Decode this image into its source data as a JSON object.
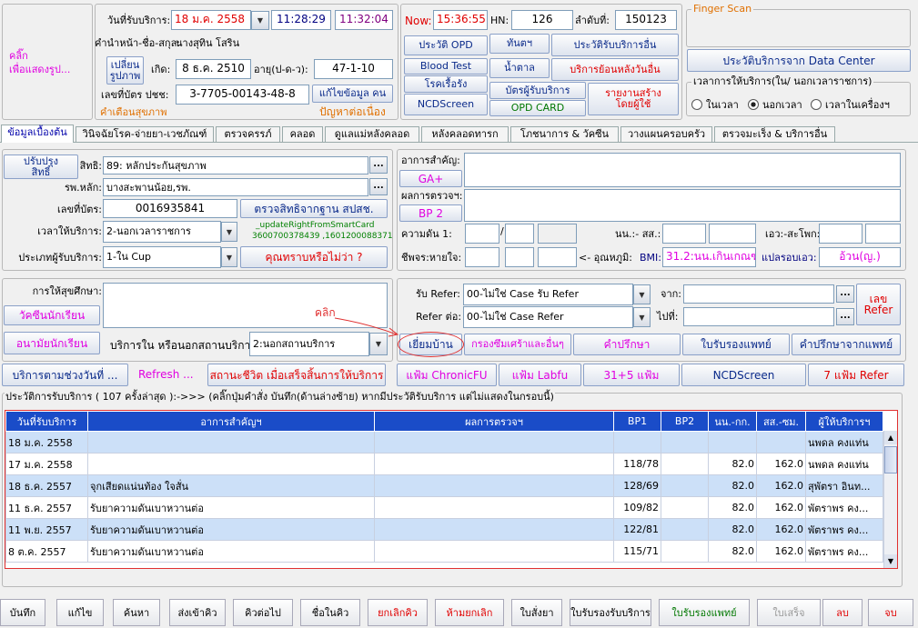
{
  "photo_area": {
    "click_label": "คลิ๊ก\nเพื่อแสดงรูป...",
    "change_photo_btn": "เปลี่ยน\nรูปภาพ",
    "warning": "คำเตือนสุขภาพ"
  },
  "patient": {
    "service_date_label": "วันที่รับบริการ:",
    "service_date": "18 ม.ค. 2558",
    "time_start": "11:28:29",
    "time_end": "11:32:04",
    "name_label": "คำนำหน้า-ชื่อ-สกุล:",
    "name": "นางสุทิน  โสริน",
    "dob_label": "เกิด:",
    "dob": "8 ธ.ค. 2510",
    "age_label": "อายุ(ป-ด-ว):",
    "age": "47-1-10",
    "cid_label": "เลขที่บัตร ปชช:",
    "cid": "3-7705-00143-48-8",
    "edit_btn": "แก้ไขข้อมูล คน",
    "problem_link": "ปัญหาต่อเนื่อง"
  },
  "visit": {
    "now_label": "Now:",
    "now": "15:36:55",
    "hn_label": "HN:",
    "hn": "126",
    "vn_label": "ลำดับที่:",
    "vn": "150123",
    "buttons": [
      "ประวัติ OPD",
      "ทันตฯ",
      "ประวัติรับบริการอื่น",
      "Blood Test",
      "น้ำตาล",
      "บริการย้อนหลังวันอื่น",
      "โรคเรื้อรัง",
      "บัตรผู้รับบริการ",
      "รายงานสร้าง\nโดยผู้ใช้ ",
      "NCDScreen",
      "OPD CARD"
    ]
  },
  "finger": {
    "title": "Finger Scan",
    "dc_btn": "ประวัติบริการจาก Data Center",
    "time_group": "เวลาการให้บริการ(ใน/ นอกเวลาราชการ)",
    "radios": [
      "ในเวลา",
      "นอกเวลา",
      "เวลาในเครื่องฯ"
    ],
    "selected": "นอกเวลา"
  },
  "tabs": [
    "ข้อมูลเบื้องต้น",
    "วินิจฉัยโรค-จ่ายยา-เวชภัณฑ์",
    "ตรวจครรภ์",
    "คลอด",
    "ดูแลแม่หลังคลอด",
    "หลังคลอดทารก",
    "โภชนาการ & วัคซีน",
    "วางแผนครอบครัว",
    "ตรวจมะเร็ง & บริการอื่น"
  ],
  "basic": {
    "update_right_btn": "ปรับปรุง\nสิทธิ์",
    "right_label": "สิทธิ:",
    "right": "89: หลักประกันสุขภาพ",
    "main_hosp_label": "รพ.หลัก:",
    "main_hosp": "บางสะพานน้อย,รพ.",
    "card_label": "เลขที่บัตร:",
    "card": "0016935841",
    "check_right_btn": "ตรวจสิทธิจากฐาน สปสช.",
    "time_label": "เวลาให้บริการ:",
    "time_value": "2-นอกเวลาราชการ",
    "smartcard_note": "_updateRightFromSmartCard",
    "smartcard_ids": "3600700378439 ,1601200088371",
    "type_label": "ประเภทผู้รับบริการ:",
    "type_value": "1-ใน Cup",
    "know_btn": "คุณทราบหรือไม่ว่า ?"
  },
  "exam": {
    "complaint_label": "อาการสำคัญ:",
    "ga_btn": "GA+",
    "result_label": "ผลการตรวจฯ:",
    "bp_btn": "BP 2",
    "bp_label": "ความดัน 1:",
    "slash": "/",
    "weight_label": "นน.:- สส.:",
    "waist_label": "เอว:-สะโพก:",
    "pulse_label": "ชีพจร:หายใจ:",
    "temp_label": "<- อุณหภูมิ:",
    "bmi_label": "BMI:",
    "bmi": "31.2:นน.เกินเกณฑ์",
    "waist_interp_label": "แปลรอบเอว:",
    "waist_interp": "อ้วน(ญ.)"
  },
  "edu": {
    "label": "การให้สุขศึกษา:",
    "vaccine_btn": "วัคซีนนักเรียน",
    "school_btn": "อนามัยนักเรียน",
    "place_label": "บริการใน หรือนอกสถานบริการ:",
    "place_value": "2:นอกสถานบริการ"
  },
  "refer": {
    "in_label": "รับ Refer:",
    "in_value": "00-ไม่ใช่ Case รับ Refer",
    "from_label": "จาก:",
    "out_label": "Refer ต่อ:",
    "out_value": "00-ไม่ใช่ Case Refer",
    "to_label": "ไปที่:",
    "refer_no_btn": "เลข\nRefer",
    "annotation": "คลิก"
  },
  "action_row": [
    "เยี่ยมบ้าน",
    "กรองซึมเศร้าและอื่นๆ",
    "คำปรึกษา",
    "ใบรับรองแพทย์",
    "คำปรึกษาจากแพทย์"
  ],
  "row2": {
    "service_by_day": "บริการตามช่วงวันที่ ...",
    "refresh": "Refresh ...",
    "status_btn": "สถานะชีวิต เมื่อเสร็จสิ้นการให้บริการ",
    "chronic": "แฟ้ม ChronicFU",
    "labfu": "แฟ้ม Labfu",
    "f315": "31+5 แฟ้ม",
    "ncd": "NCDScreen",
    "refer7": "7 แฟ้ม Refer"
  },
  "history": {
    "caption": "ประวัติการรับบริการ ( 107 ครั้งล่าสุด ):->>> (คลิ๊กปุ่มคำสั่ง บันทึก(ด้านล่างซ้าย) หากมีประวัติรับบริการ แต่ไม่แสดงในกรอบนี้)",
    "columns": [
      "วันที่รับบริการ",
      "อาการสำคัญฯ",
      "ผลการตรวจฯ",
      "BP1",
      "BP2",
      "นน.-กก.",
      "สส.-ซม.",
      "ผู้ให้บริการฯ"
    ],
    "rows": [
      [
        "18 ม.ค. 2558",
        "",
        "",
        "",
        "",
        "",
        "",
        "นพดล คงแท่น"
      ],
      [
        "17 ม.ค. 2558",
        "",
        "",
        "118/78",
        "",
        "82.0",
        "162.0",
        "นพดล คงแท่น"
      ],
      [
        "18 ธ.ค. 2557",
        "จุกเสียดแน่นท้อง ใจสั่น",
        "",
        "128/69",
        "",
        "82.0",
        "162.0",
        "สุพัตรา อินท..."
      ],
      [
        "11 ธ.ค. 2557",
        "รับยาความดันเบาหวานต่อ",
        "",
        "109/82",
        "",
        "82.0",
        "162.0",
        "พัตราพร คง..."
      ],
      [
        "11 พ.ย. 2557",
        "รับยาความดันเบาหวานต่อ",
        "",
        "122/81",
        "",
        "82.0",
        "162.0",
        "พัตราพร คง..."
      ],
      [
        "8 ต.ค. 2557",
        "รับยาความดันเบาหวานต่อ",
        "",
        "115/71",
        "",
        "82.0",
        "162.0",
        "พัตราพร คง..."
      ]
    ]
  },
  "bottom": [
    "บันทึก",
    "แก้ไข",
    "ค้นหา",
    "ส่งเข้าคิว",
    "คิวต่อไป",
    "ชื่อในคิว",
    "ยกเลิกคิว",
    "ห้ามยกเลิก",
    "ใบสั่งยา",
    "ใบรับรองรับบริการ",
    "ใบรับรองแพทย์",
    "ใบเสร็จ",
    "ลบ",
    "จบ"
  ]
}
